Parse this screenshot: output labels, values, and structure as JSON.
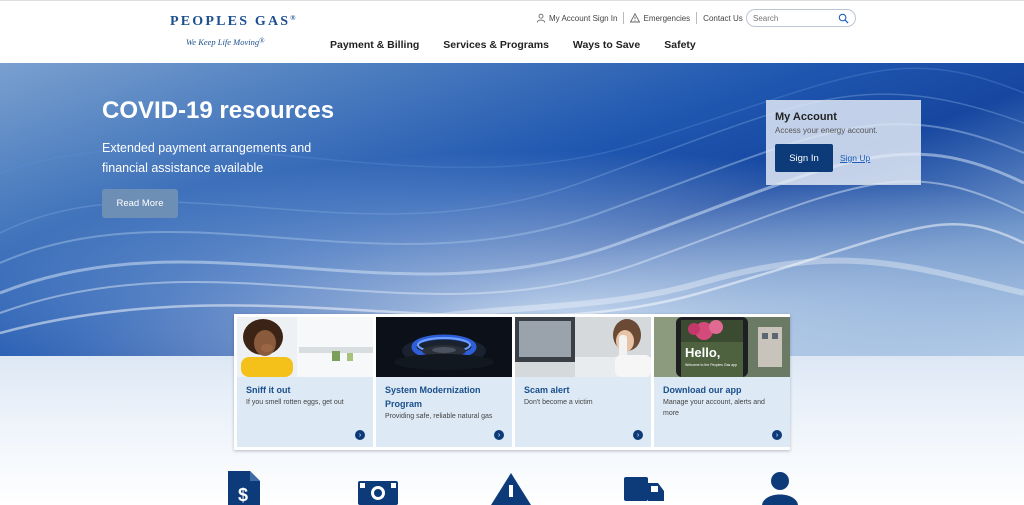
{
  "brand": {
    "name": "PEOPLES GAS",
    "tagline": "We Keep Life Moving"
  },
  "utility": {
    "account_signin": "My Account Sign In",
    "emergencies": "Emergencies",
    "contact": "Contact Us",
    "search_placeholder": "Search"
  },
  "nav": {
    "items": [
      "Payment & Billing",
      "Services & Programs",
      "Ways to Save",
      "Safety"
    ]
  },
  "hero": {
    "title": "COVID-19 resources",
    "subtitle": "Extended payment arrangements and financial assistance available",
    "button": "Read More"
  },
  "account": {
    "title": "My Account",
    "description": "Access your energy account.",
    "signin": "Sign In",
    "signup": "Sign Up"
  },
  "cards": [
    {
      "title": "Sniff it out",
      "desc": "If you smell rotten eggs, get out",
      "image": "woman-covering-nose"
    },
    {
      "title": "System Modernization Program",
      "desc": "Providing safe, reliable natural gas",
      "image": "gas-burner-flame"
    },
    {
      "title": "Scam alert",
      "desc": "Don't become a victim",
      "image": "person-on-phone"
    },
    {
      "title": "Download our app",
      "desc": "Manage your account, alerts and more",
      "image": "phone-app-hello",
      "phone_text": "Hello,",
      "phone_subtext": "Welcome to the Peoples Gas app"
    }
  ],
  "bottom_icons": [
    "bill-icon",
    "money-icon",
    "warning-icon",
    "truck-icon",
    "person-icon"
  ],
  "colors": {
    "brand_navy": "#0d3b7a",
    "brand_blue": "#1b4f8f",
    "card_bg": "#dde9f5"
  }
}
